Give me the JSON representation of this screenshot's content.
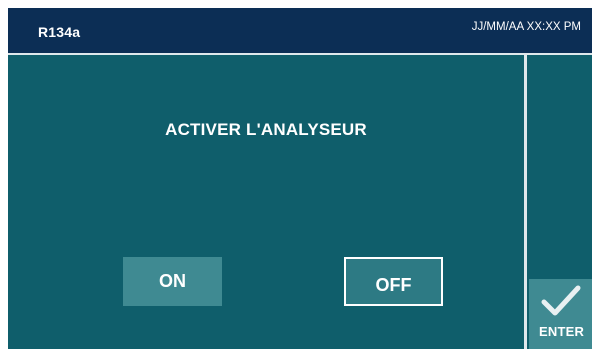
{
  "header": {
    "model": "R134a",
    "datetime": "JJ/MM/AA XX:XX PM"
  },
  "prompt": {
    "title": "ACTIVER L'ANALYSEUR"
  },
  "buttons": {
    "on_label": "ON",
    "off_label": "OFF",
    "enter_label": "ENTER",
    "enter_icon": "checkmark-icon"
  },
  "colors": {
    "background": "#0f5e6b",
    "header": "#0c2e55",
    "button": "#3f8a92",
    "divider": "#dfe8ec"
  }
}
